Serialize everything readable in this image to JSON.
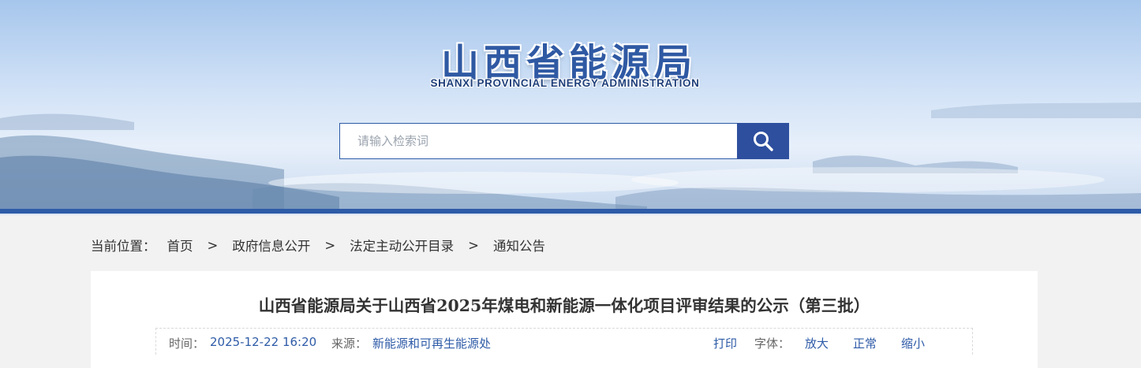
{
  "header": {
    "title_cn": "山西省能源局",
    "title_en": "SHANXI PROVINCIAL ENERGY ADMINISTRATION",
    "search_placeholder": "请输入检索词",
    "search_icon": "magnifier-icon",
    "accent_color": "#2e5ba7"
  },
  "breadcrumb": {
    "label": "当前位置：",
    "items": [
      "首页",
      "政府信息公开",
      "法定主动公开目录",
      "通知公告"
    ],
    "separator": ">"
  },
  "article": {
    "title": "山西省能源局关于山西省2025年煤电和新能源一体化项目评审结果的公示（第三批）",
    "time_label": "时间：",
    "time_value": "2025-12-22 16:20",
    "source_label": "来源：",
    "source_value": "新能源和可再生能源处",
    "print_label": "打印",
    "font_label": "字体：",
    "font_large": "放大",
    "font_normal": "正常",
    "font_small": "缩小"
  }
}
